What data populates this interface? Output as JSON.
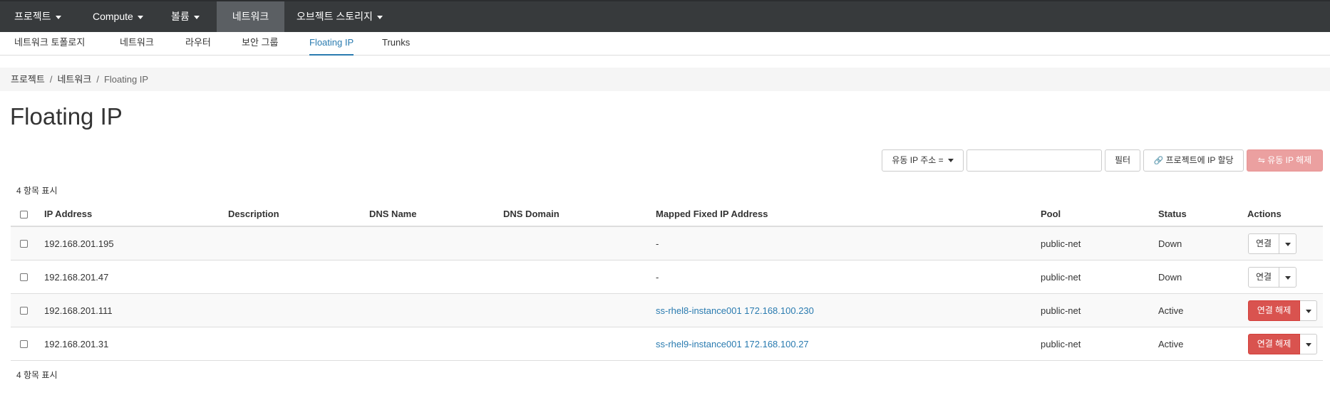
{
  "topnav": {
    "items": [
      {
        "label": "프로젝트",
        "caret": true,
        "active": false
      },
      {
        "label": "Compute",
        "caret": true,
        "active": false
      },
      {
        "label": "볼륨",
        "caret": true,
        "active": false
      },
      {
        "label": "네트워크",
        "caret": false,
        "active": true
      },
      {
        "label": "오브젝트 스토리지",
        "caret": true,
        "active": false
      }
    ]
  },
  "subnav": {
    "tabs": [
      {
        "label": "네트워크 토폴로지"
      },
      {
        "label": "네트워크"
      },
      {
        "label": "라우터"
      },
      {
        "label": "보안 그룹"
      },
      {
        "label": "Floating IP",
        "active": true
      },
      {
        "label": "Trunks"
      }
    ]
  },
  "breadcrumb": {
    "items": [
      "프로젝트",
      "네트워크"
    ],
    "current": "Floating IP"
  },
  "page_title": "Floating IP",
  "toolbar": {
    "filter_select": "유동 IP 주소 =",
    "filter_input_value": "",
    "filter_button": "필터",
    "allocate_button": "프로젝트에 IP 할당",
    "release_button": "유동 IP 해제"
  },
  "count_text": "4 항목 표시",
  "table": {
    "columns": [
      "IP Address",
      "Description",
      "DNS Name",
      "DNS Domain",
      "Mapped Fixed IP Address",
      "Pool",
      "Status",
      "Actions"
    ],
    "rows": [
      {
        "ip": "192.168.201.195",
        "description": "",
        "dns_name": "",
        "dns_domain": "",
        "mapped": "-",
        "mapped_link": false,
        "pool": "public-net",
        "status": "Down",
        "action": "연결",
        "action_danger": false
      },
      {
        "ip": "192.168.201.47",
        "description": "",
        "dns_name": "",
        "dns_domain": "",
        "mapped": "-",
        "mapped_link": false,
        "pool": "public-net",
        "status": "Down",
        "action": "연결",
        "action_danger": false
      },
      {
        "ip": "192.168.201.111",
        "description": "",
        "dns_name": "",
        "dns_domain": "",
        "mapped": "ss-rhel8-instance001 172.168.100.230",
        "mapped_link": true,
        "pool": "public-net",
        "status": "Active",
        "action": "연결 해제",
        "action_danger": true
      },
      {
        "ip": "192.168.201.31",
        "description": "",
        "dns_name": "",
        "dns_domain": "",
        "mapped": "ss-rhel9-instance001 172.168.100.27",
        "mapped_link": true,
        "pool": "public-net",
        "status": "Active",
        "action": "연결 해제",
        "action_danger": true
      }
    ]
  },
  "colors": {
    "topnav_bg": "#373a3c",
    "topnav_active": "#5b5f63",
    "link": "#2a7bb0",
    "danger": "#d9534f",
    "danger_disabled": "#eba0a0"
  }
}
